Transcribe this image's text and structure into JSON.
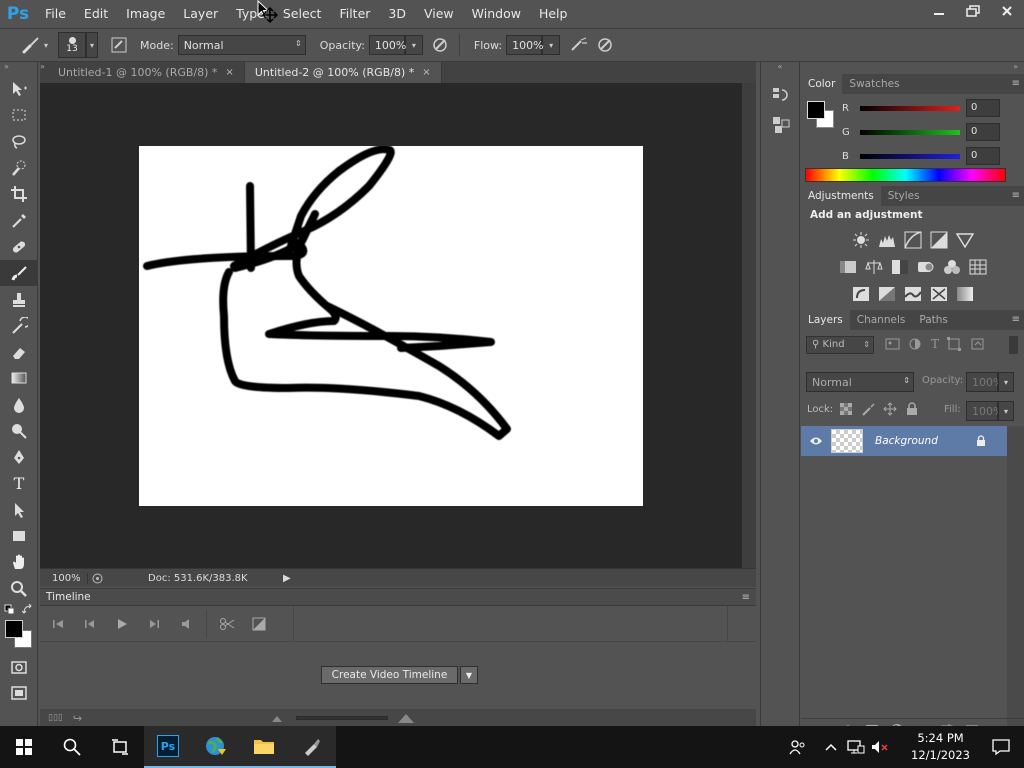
{
  "app": {
    "logo": "Ps",
    "brand_color": "#2fa3e6"
  },
  "menu": [
    "File",
    "Edit",
    "Image",
    "Layer",
    "Type",
    "Select",
    "Filter",
    "3D",
    "View",
    "Window",
    "Help"
  ],
  "options": {
    "brush_size": "13",
    "mode_label": "Mode:",
    "mode_value": "Normal",
    "opacity_label": "Opacity:",
    "opacity_value": "100%",
    "flow_label": "Flow:",
    "flow_value": "100%"
  },
  "tabs": [
    {
      "label": "Untitled-1 @ 100% (RGB/8) *",
      "active": false
    },
    {
      "label": "Untitled-2 @ 100% (RGB/8) *",
      "active": true
    }
  ],
  "status": {
    "zoom": "100%",
    "doc": "Doc: 531.6K/383.8K"
  },
  "timeline": {
    "title": "Timeline",
    "create_button": "Create Video Timeline"
  },
  "color_panel": {
    "tabs": [
      "Color",
      "Swatches"
    ],
    "channels": [
      {
        "label": "R",
        "value": "0",
        "color": "#e02020"
      },
      {
        "label": "G",
        "value": "0",
        "color": "#20c020"
      },
      {
        "label": "B",
        "value": "0",
        "color": "#2020e0"
      }
    ]
  },
  "adjustments_panel": {
    "tabs": [
      "Adjustments",
      "Styles"
    ],
    "heading": "Add an adjustment"
  },
  "layers_panel": {
    "tabs": [
      "Layers",
      "Channels",
      "Paths"
    ],
    "filter_kind": "Kind",
    "blend_mode": "Normal",
    "opacity_label": "Opacity:",
    "opacity_value": "100%",
    "lock_label": "Lock:",
    "fill_label": "Fill:",
    "fill_value": "100%",
    "layers": [
      {
        "name": "Background",
        "visible": true,
        "locked": true
      }
    ]
  },
  "taskbar": {
    "time": "5:24 PM",
    "date": "12/1/2023"
  }
}
